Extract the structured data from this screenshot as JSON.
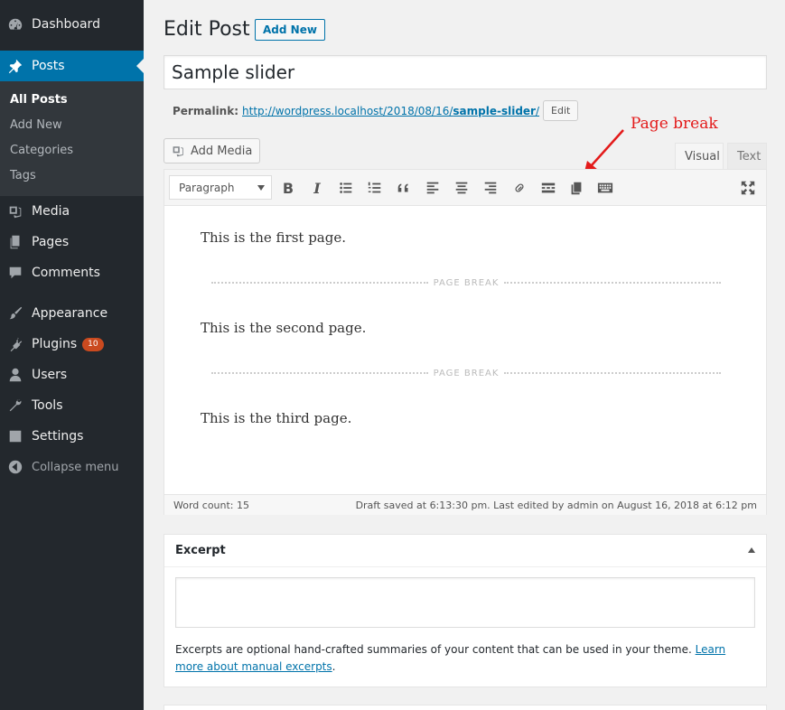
{
  "sidebar": {
    "dashboard": "Dashboard",
    "posts": "Posts",
    "submenu": [
      "All Posts",
      "Add New",
      "Categories",
      "Tags"
    ],
    "media": "Media",
    "pages": "Pages",
    "comments": "Comments",
    "appearance": "Appearance",
    "plugins": "Plugins",
    "plugins_badge": "10",
    "users": "Users",
    "tools": "Tools",
    "settings": "Settings",
    "collapse": "Collapse menu"
  },
  "header": {
    "title": "Edit Post",
    "add_new": "Add New"
  },
  "post": {
    "title_value": "Sample slider",
    "permalink_label": "Permalink:",
    "permalink_base": "http://wordpress.localhost/2018/08/16/",
    "permalink_slug": "sample-slider",
    "permalink_trail": "/",
    "permalink_edit": "Edit"
  },
  "editor": {
    "add_media": "Add Media",
    "tab_visual": "Visual",
    "tab_text": "Text",
    "format_select": "Paragraph",
    "toolbar_bold": "B",
    "toolbar_italic": "I",
    "paragraphs": [
      "This is the first page.",
      "This is the second page.",
      "This is the third page."
    ],
    "page_break_label": "PAGE BREAK",
    "word_count": "Word count: 15",
    "draft_status": "Draft saved at 6:13:30 pm. Last edited by admin on August 16, 2018 at 6:12 pm"
  },
  "annotation": {
    "label": "Page break",
    "color": "#e31a1a"
  },
  "excerpt": {
    "title": "Excerpt",
    "help_text": "Excerpts are optional hand-crafted summaries of your content that can be used in your theme. ",
    "help_link": "Learn more about manual excerpts",
    "help_end": "."
  },
  "colors": {
    "sidebar_bg": "#23282d",
    "active_bg": "#0073aa",
    "link": "#0073aa",
    "badge": "#ca4a1f"
  }
}
